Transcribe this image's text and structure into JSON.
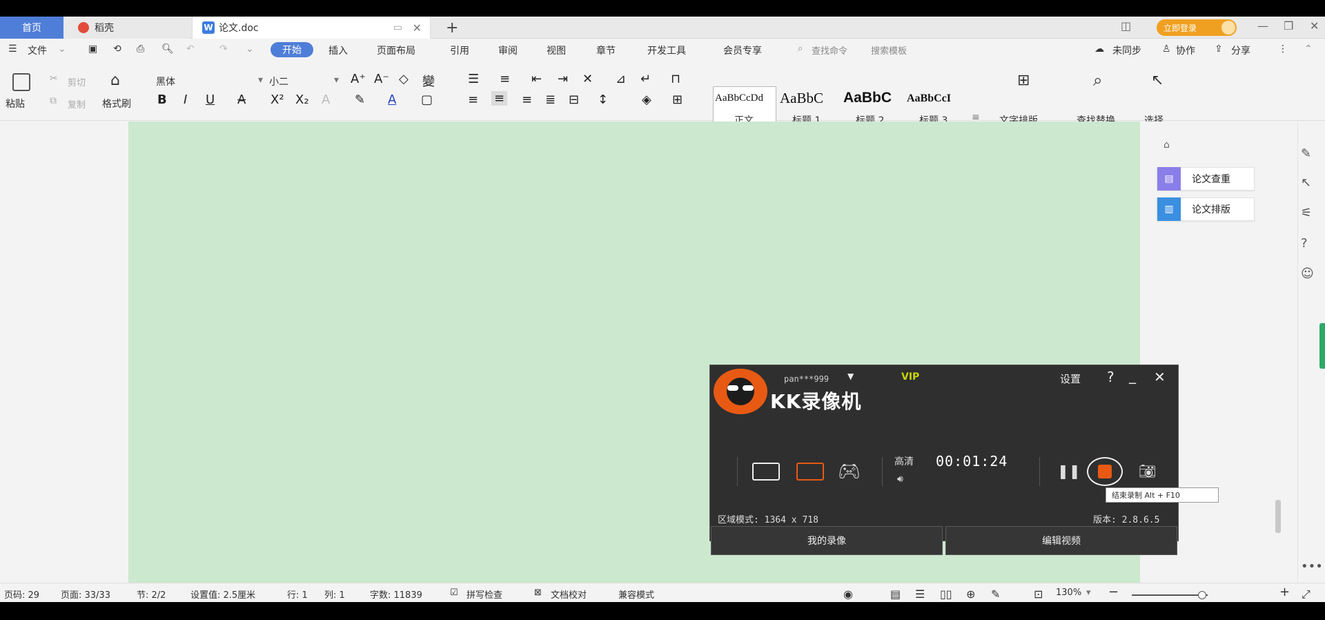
{
  "tabs": {
    "home": "首页",
    "daoke": "稻壳",
    "doc": "论文.doc",
    "login": "立即登录"
  },
  "menu": {
    "file": "文件",
    "items": [
      "开始",
      "插入",
      "页面布局",
      "引用",
      "审阅",
      "视图",
      "章节",
      "开发工具",
      "会员专享"
    ],
    "search_cmd": "查找命令",
    "search_tpl": "搜索模板",
    "sync": "未同步",
    "collab": "协作",
    "share": "分享"
  },
  "ribbon": {
    "paste": "粘贴",
    "cut": "剪切",
    "copy": "复制",
    "format_painter": "格式刷",
    "font": "黑体",
    "size": "小二",
    "styles": [
      {
        "preview": "AaBbCcDd",
        "name": "正文"
      },
      {
        "preview": "AaBbC",
        "name": "标题 1"
      },
      {
        "preview": "AaBbC",
        "name": "标题 2"
      },
      {
        "preview": "AaBbCcI",
        "name": "标题 3"
      }
    ],
    "text_layout": "文字排版",
    "find_replace": "查找替换",
    "select": "选择"
  },
  "pane": {
    "check": "论文查重",
    "layout": "论文排版"
  },
  "status": {
    "page_code": "页码: 29",
    "pages": "页面: 33/33",
    "section": "节: 2/2",
    "setting": "设置值: 2.5厘米",
    "row": "行: 1",
    "col": "列: 1",
    "words": "字数: 11839",
    "spell": "拼写检查",
    "proof": "文档校对",
    "compat": "兼容模式",
    "zoom": "130%"
  },
  "kk": {
    "title": "KK录像机",
    "user": "pan***999",
    "vip": "VIP",
    "settings": "设置",
    "quality": "高清",
    "time": "00:01:24",
    "tooltip": "结束录制 Alt + F10",
    "mode_info": "区域模式: 1364 x 718",
    "version": "版本: 2.8.6.5",
    "my_videos": "我的录像",
    "edit_video": "编辑视频"
  }
}
